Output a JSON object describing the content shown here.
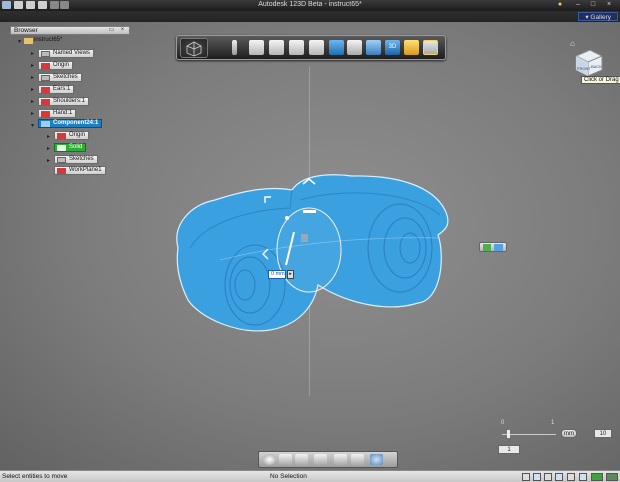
{
  "window": {
    "title": "Autodesk 123D Beta  -  instruct65*",
    "gallery_label": "Gallery",
    "min": "–",
    "max": "□",
    "close": "×"
  },
  "browser": {
    "title": "Browser",
    "nodes": [
      {
        "label": "instruct65*"
      },
      {
        "label": "Named Views"
      },
      {
        "label": "Origin"
      },
      {
        "label": "Sketches"
      },
      {
        "label": "Ears:1"
      },
      {
        "label": "Shoulders:1"
      },
      {
        "label": "Hand:1"
      },
      {
        "label": "Component24:1"
      },
      {
        "label": "Origin"
      },
      {
        "label": "Solid"
      },
      {
        "label": "Sketches"
      },
      {
        "label": "WorkPlane1"
      }
    ]
  },
  "viewcube": {
    "tooltip": "Click or Drag",
    "face_front": "FRONT",
    "face_back": "BACK"
  },
  "manipulator": {
    "dimension_value": "0 mm"
  },
  "zoom": {
    "min_label": "0",
    "max_label": "1",
    "unit": "mm",
    "value": "10",
    "snap_value": "1",
    "slider_fraction": 0.12
  },
  "status": {
    "left": "Select entities to move",
    "middle": "No Selection"
  },
  "colors": {
    "model": "#3aa0e0",
    "selection": "#1c7fc3",
    "solid_green": "#2fae35"
  }
}
